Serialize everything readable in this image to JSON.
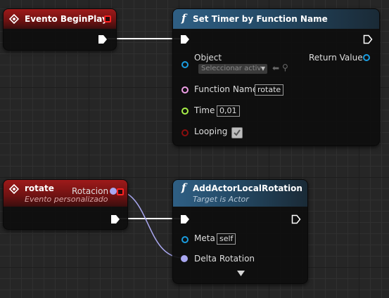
{
  "nodes": {
    "begin_play": {
      "title": "Evento BeginPlay"
    },
    "set_timer": {
      "title": "Set Timer by Function Name",
      "pins": {
        "object": "Object",
        "object_combo": "Seleccionar activ",
        "function_name": "Function Name",
        "function_name_value": "rotate",
        "time": "Time",
        "time_value": "0,01",
        "looping": "Looping",
        "return_value": "Return Value"
      }
    },
    "rotate_event": {
      "title": "rotate",
      "subtitle": "Evento personalizado",
      "pins": {
        "rotacion": "Rotacion"
      }
    },
    "add_rotation": {
      "title": "AddActorLocalRotation",
      "subtitle": "Target is Actor",
      "pins": {
        "meta": "Meta",
        "meta_value": "self",
        "delta_rotation": "Delta Rotation"
      }
    }
  },
  "state": {
    "looping_checked": true
  },
  "icons": {
    "event": "diamond-event-icon",
    "function": "function-f-icon",
    "exec": "exec-pin-icon",
    "delegate": "delegate-square-icon"
  },
  "colors": {
    "event_header": "#9e1a1a",
    "function_header": "#2f5f84",
    "object_pin": "#1a9de0",
    "string_pin": "#f0a0e8",
    "float_pin": "#a7f048",
    "bool_pin": "#8b0e0e",
    "struct_pin": "#a9a7f0",
    "delegate_pin": "#ff2222"
  }
}
